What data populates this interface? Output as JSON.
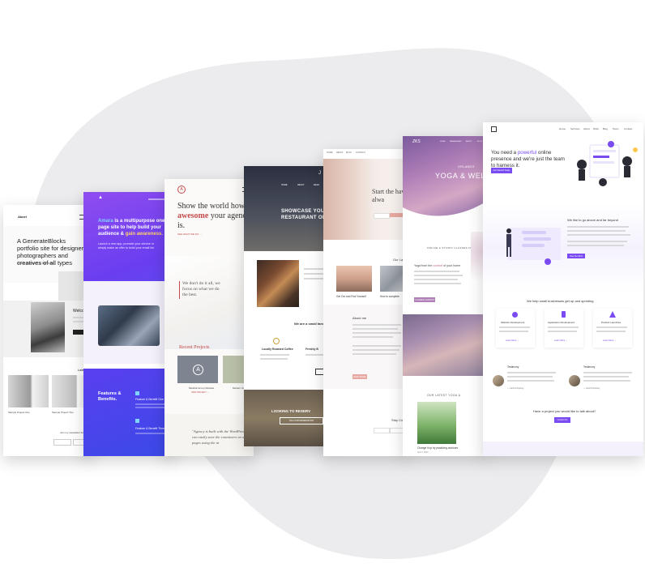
{
  "colors": {
    "blob": "#ececee",
    "purple": "#7a4bf0",
    "violet": "#8a55e6",
    "red": "#c44a4a",
    "dark": "#3a3d45",
    "gold": "#c9a13b"
  },
  "card1": {
    "logo": "Aknel",
    "headline": "A GenerateBlocks portfolio site for designers, photographers and creatives of all types",
    "sub": "Show your work to the world",
    "welcome": "Welcom",
    "latest": "Late",
    "project1": "Sample Project One",
    "project2": "Sample Project Two",
    "newsletter": "Join my newsletter for",
    "news_btn": "Sign Up"
  },
  "card2": {
    "brand": "Amara",
    "headline_parts": [
      "Amara",
      " is a multipurpose one page site to help build your audience & ",
      "gain awareness."
    ],
    "sub": "Launch a new app, promote your service or simply make an offer to build your email list.",
    "features": "Features & Benefits.",
    "feature1": "Feature & Benefit One",
    "feature2": "Feature & Benefit Three"
  },
  "card3": {
    "headline_parts": [
      "Show the world how ",
      "awesome",
      " your agency is."
    ],
    "link": "SEE WHAT WE DO →",
    "quote": "We don't do it all, we focus on what we do the best.",
    "recent": "Recent Projects",
    "proj1": "Medical Group Website",
    "proj2": "Modern Cate",
    "proj_link": "VIEW PROJECT →",
    "testimonial": "\"Agency is built with the WordPress. You can easily save the containers on other pages using the at"
  },
  "card4": {
    "logo": "J",
    "nav": [
      "HOME",
      "ABOUT",
      "MENU"
    ],
    "headline": "SHOWCASE YOU RESTAURANT OR",
    "small_team": "We are a small family b",
    "item1_title": "Locally Roasted Coffee",
    "item2_title": "Freshly B",
    "looking": "LOOKING TO RESERV",
    "reserve_btn": "CALL FOR RESERVATION"
  },
  "card5": {
    "nav": [
      "HOME",
      "ABOUT",
      "BLOG",
      "CONTACT"
    ],
    "hero": "Start the have alwa",
    "latest": "Our Late",
    "post1": "Get Out and Find Yourself",
    "post2": "How to complete",
    "about": "About me",
    "read_more": "READ MORE",
    "stay": "Stay Co"
  },
  "card6": {
    "logo": "ZKS",
    "nav": [
      "HOME",
      "MEMBERSHIP",
      "ABOUT",
      "BLOG"
    ],
    "kicker": "ORLANDO",
    "headline": "YOGA & WELL",
    "sub": "ONLINE & STUDIO CLASSES FROM",
    "yoga_title_parts": [
      "Yoga from the ",
      "comfort",
      " of your home"
    ],
    "btn": "CLASSES & EVENTS",
    "latest": "OUR LATEST YOGA &",
    "post": "Change it up by practicing outdoors",
    "date": "April 1, 2020"
  },
  "card7": {
    "nav": [
      "Home",
      "Services",
      "About",
      "Work",
      "Blog",
      "Team",
      "Contact"
    ],
    "headline_parts": [
      "You need a ",
      "powerful",
      " online presence and we're just the team to harness it."
    ],
    "hero_btn": "Get Started Today",
    "above": "We like to go above and far beyond",
    "above_btn": "View Our Work",
    "help": "We help small businesses get up and sprinting",
    "svc1": "Website Development",
    "svc2": "Application Development",
    "svc3": "Product Launches",
    "learn": "Learn More →",
    "name1": "Testimony",
    "name2": "Testimony",
    "cap1": "— Carol Humphrey",
    "cap2": "— Carol Humphrey",
    "talk": "Have a project you would like to talk about?",
    "talk_btn": "Contact Us"
  }
}
